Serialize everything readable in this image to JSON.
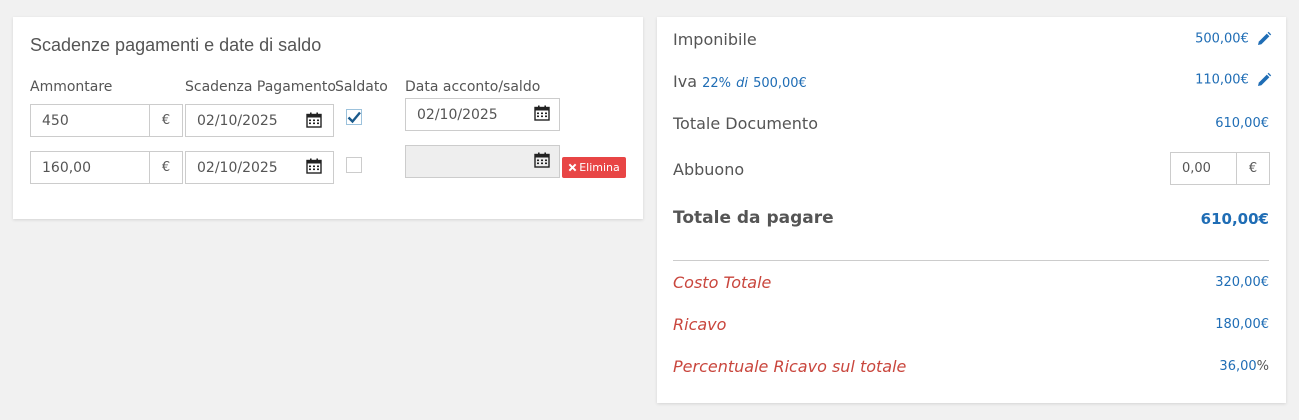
{
  "payments": {
    "title": "Scadenze pagamenti e date di saldo",
    "col_amount": "Ammontare",
    "col_due": "Scadenza Pagamento",
    "col_paid": "Saldato",
    "col_settle": "Data acconto/saldo",
    "currency": "€",
    "rows": [
      {
        "amount": "450",
        "due_date": "02/10/2025",
        "paid": true,
        "settle_date": "02/10/2025"
      },
      {
        "amount": "160,00",
        "due_date": "02/10/2025",
        "paid": false,
        "settle_date": "",
        "delete_label": "Elimina"
      }
    ]
  },
  "totals": {
    "imponibile_label": "Imponibile",
    "imponibile_value": "500,00€",
    "iva_label": "Iva",
    "iva_rate": "22%",
    "iva_di": "di",
    "iva_base": "500,00€",
    "iva_value": "110,00€",
    "totale_doc_label": "Totale Documento",
    "totale_doc_value": "610,00€",
    "abbuono_label": "Abbuono",
    "abbuono_value": "0,00",
    "abbuono_currency": "€",
    "totale_pagare_label": "Totale da pagare",
    "totale_pagare_value": "610,00€",
    "costo_label": "Costo Totale",
    "costo_value": "320,00€",
    "ricavo_label": "Ricavo",
    "ricavo_value": "180,00€",
    "percentuale_label": "Percentuale Ricavo sul totale",
    "percentuale_value": "36,00",
    "percentuale_unit": "%"
  },
  "colors": {
    "accent": "#1f6db5",
    "danger": "#e84545",
    "margin_text": "#c9463d"
  },
  "icons": [
    "calendar-icon",
    "check-icon",
    "close-icon",
    "pencil-icon"
  ]
}
